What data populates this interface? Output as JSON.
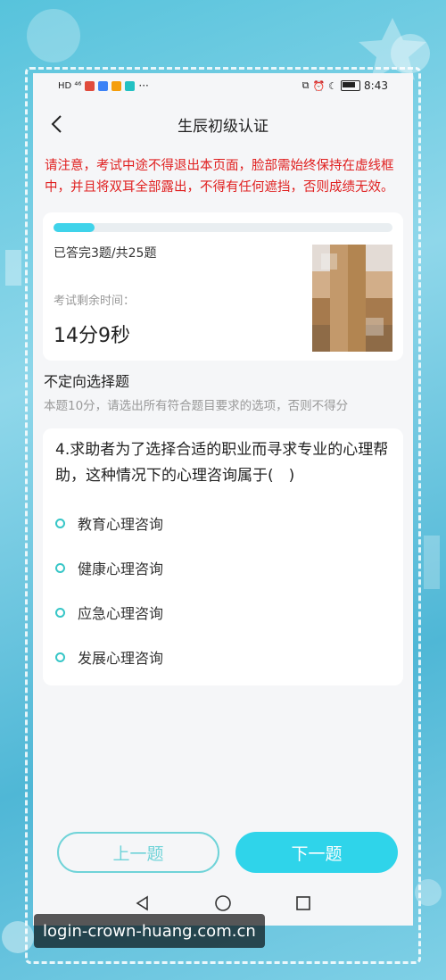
{
  "status_bar": {
    "left": "HD ⁴⁶",
    "time": "8:43",
    "battery": "▮"
  },
  "header": {
    "title": "生辰初级认证",
    "back_icon": "chevron-left-icon"
  },
  "warning": "请注意，考试中途不得退出本页面，脸部需始终保持在虚线框中，并且将双耳全部露出，不得有任何遮挡，否则成绩无效。",
  "progress": {
    "answered_text": "已答完3题/共25题",
    "fraction": 0.12,
    "remaining_label": "考试剩余时间：",
    "remaining_value": "14分9秒"
  },
  "section": {
    "title": "不定向选择题",
    "description": "本题10分，请选出所有符合题目要求的选项，否则不得分"
  },
  "question": {
    "text": "4.求助者为了选择合适的职业而寻求专业的心理帮助，这种情况下的心理咨询属于(　)",
    "options": [
      "教育心理咨询",
      "健康心理咨询",
      "应急心理咨询",
      "发展心理咨询"
    ]
  },
  "buttons": {
    "prev": "上一题",
    "next": "下一题"
  },
  "colors": {
    "accent": "#2fd4ea",
    "warning": "#e02020"
  },
  "watermark": "login-crown-huang.com.cn"
}
